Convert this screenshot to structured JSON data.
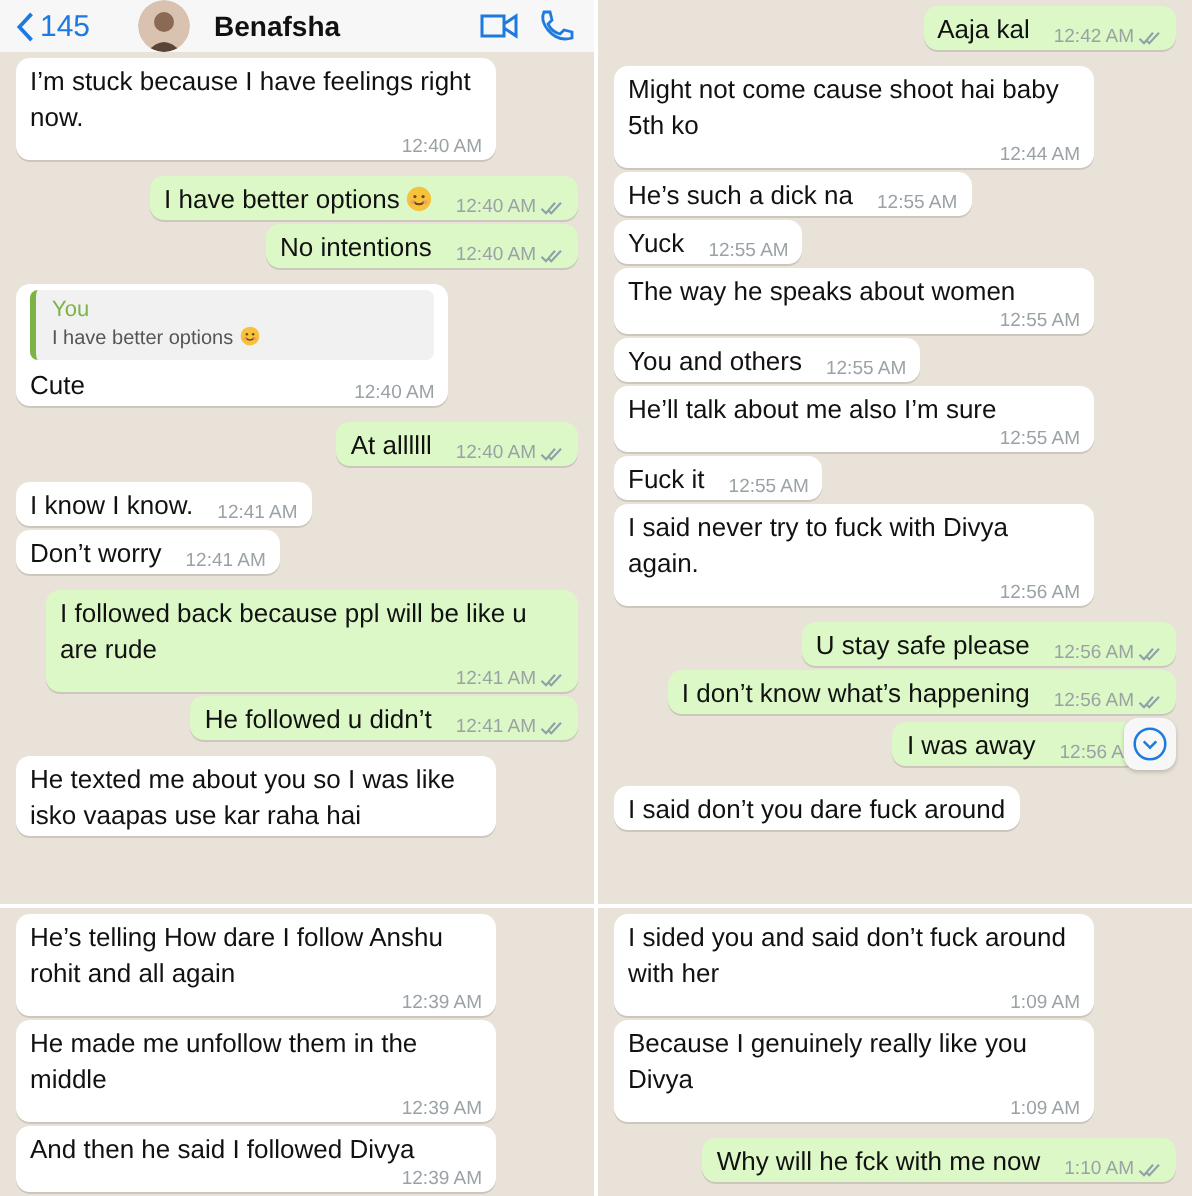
{
  "panels": [
    {
      "header": {
        "back_count": "145",
        "contact_name": "Benafsha"
      },
      "messages": [
        {
          "kind": "incoming",
          "text": "I’m stuck because I have feelings right now.",
          "time": "12:40 AM"
        },
        {
          "kind": "outgoing",
          "text": "I have better options",
          "emoji": true,
          "time": "12:40 AM"
        },
        {
          "kind": "outgoing",
          "text": "No intentions",
          "time": "12:40 AM"
        },
        {
          "kind": "incoming",
          "quote": {
            "author": "You",
            "text": "I have better options",
            "emoji": true
          },
          "text": "Cute",
          "time": "12:40 AM"
        },
        {
          "kind": "outgoing",
          "text": "At allllll",
          "time": "12:40 AM"
        },
        {
          "kind": "incoming",
          "text": "I know I know.",
          "time": "12:41 AM"
        },
        {
          "kind": "incoming",
          "text": "Don’t worry",
          "time": "12:41 AM"
        },
        {
          "kind": "outgoing",
          "text": "I followed back because ppl will be like u are rude",
          "time": "12:41 AM"
        },
        {
          "kind": "outgoing",
          "text": "He followed u didn’t",
          "time": "12:41 AM"
        },
        {
          "kind": "incoming",
          "text": "He texted me about you so I was like isko vaapas use kar raha hai"
        }
      ]
    },
    {
      "messages": [
        {
          "kind": "outgoing",
          "text": "Aaja kal",
          "time": "12:42 AM"
        },
        {
          "kind": "incoming",
          "text": "Might not come cause shoot hai baby 5th ko",
          "time": "12:44 AM"
        },
        {
          "kind": "incoming",
          "text": "He’s such a dick na",
          "time": "12:55 AM"
        },
        {
          "kind": "incoming",
          "text": "Yuck",
          "time": "12:55 AM"
        },
        {
          "kind": "incoming",
          "text": "The way he speaks about women",
          "time": "12:55 AM"
        },
        {
          "kind": "incoming",
          "text": "You and others",
          "time": "12:55 AM"
        },
        {
          "kind": "incoming",
          "text": "He’ll talk about me also I’m sure",
          "time": "12:55 AM"
        },
        {
          "kind": "incoming",
          "text": "Fuck it",
          "time": "12:55 AM"
        },
        {
          "kind": "incoming",
          "text": "I said never try to fuck with Divya again.",
          "time": "12:56 AM"
        },
        {
          "kind": "outgoing",
          "text": "U stay safe please",
          "time": "12:56 AM"
        },
        {
          "kind": "outgoing",
          "text": "I don’t know what’s happening",
          "time": "12:56 AM"
        },
        {
          "kind": "outgoing",
          "text": "I was away",
          "time": "12:56 A",
          "scroll_down_button": true
        },
        {
          "kind": "incoming",
          "text": "I said don’t you dare fuck around"
        }
      ]
    },
    {
      "messages": [
        {
          "kind": "incoming",
          "text": "He’s telling How dare I follow Anshu rohit and all again",
          "time": "12:39 AM"
        },
        {
          "kind": "incoming",
          "text": "He made me unfollow them in the middle",
          "time": "12:39 AM"
        },
        {
          "kind": "incoming",
          "text": "And then he said I followed Divya",
          "time": "12:39 AM"
        }
      ]
    },
    {
      "messages": [
        {
          "kind": "incoming",
          "text": "I sided you and said don’t fuck around with her",
          "time": "1:09 AM"
        },
        {
          "kind": "incoming",
          "text": "Because I genuinely really like you Divya",
          "time": "1:09 AM"
        },
        {
          "kind": "outgoing",
          "text": "Why will he fck with me now",
          "time": "1:10 AM"
        }
      ]
    }
  ]
}
